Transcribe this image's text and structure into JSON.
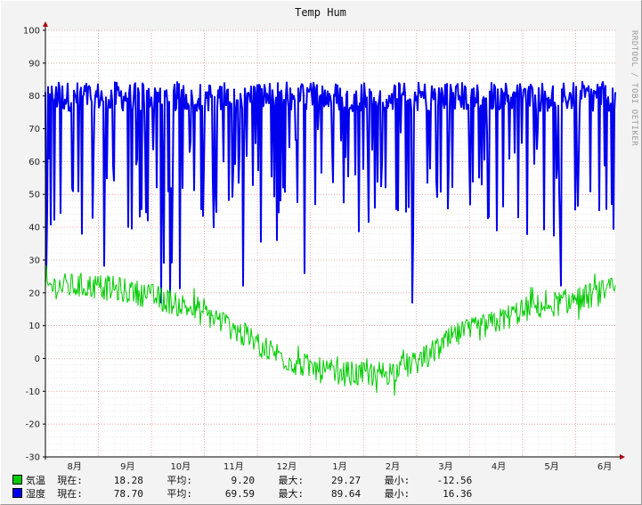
{
  "chart_data": {
    "type": "line",
    "title": "Temp Hum",
    "xlabel": "",
    "ylabel": "",
    "ylim": [
      -30,
      100
    ],
    "yticks": [
      -30,
      -20,
      -10,
      0,
      10,
      20,
      30,
      40,
      50,
      60,
      70,
      80,
      90,
      100
    ],
    "x_range_months": [
      7.55,
      18.3
    ],
    "month_ticks": [
      {
        "label": "8月",
        "pos": 8.1
      },
      {
        "label": "9月",
        "pos": 9.1
      },
      {
        "label": "10月",
        "pos": 10.1
      },
      {
        "label": "11月",
        "pos": 11.1
      },
      {
        "label": "12月",
        "pos": 12.1
      },
      {
        "label": "1月",
        "pos": 13.1
      },
      {
        "label": "2月",
        "pos": 14.1
      },
      {
        "label": "3月",
        "pos": 15.1
      },
      {
        "label": "4月",
        "pos": 16.1
      },
      {
        "label": "5月",
        "pos": 17.1
      },
      {
        "label": "6月",
        "pos": 18.1
      }
    ],
    "grid": true,
    "series": [
      {
        "name": "気温",
        "color": "#00cc00",
        "trend": [
          [
            7.55,
            22
          ],
          [
            8.5,
            22
          ],
          [
            9.3,
            20
          ],
          [
            10.0,
            17
          ],
          [
            10.8,
            12
          ],
          [
            11.5,
            5
          ],
          [
            12.2,
            -1
          ],
          [
            12.8,
            -4
          ],
          [
            13.5,
            -5
          ],
          [
            14.1,
            -4
          ],
          [
            14.7,
            0
          ],
          [
            15.3,
            7
          ],
          [
            15.9,
            10
          ],
          [
            16.6,
            15
          ],
          [
            17.3,
            17
          ],
          [
            17.8,
            19
          ],
          [
            18.3,
            21
          ]
        ],
        "stats": {
          "current": "18.28",
          "average": "9.20",
          "max": "29.27",
          "min": "-12.56"
        }
      },
      {
        "name": "湿度",
        "color": "#0000ee",
        "baseline": 78,
        "stats": {
          "current": "78.70",
          "average": "69.59",
          "max": "89.64",
          "min": "16.36"
        }
      }
    ]
  },
  "legend_labels": {
    "current": "現在:",
    "average": "平均:",
    "max": "最大:",
    "min": "最小:"
  },
  "side_label": "RRDTOOL / TOBI OETIKER"
}
